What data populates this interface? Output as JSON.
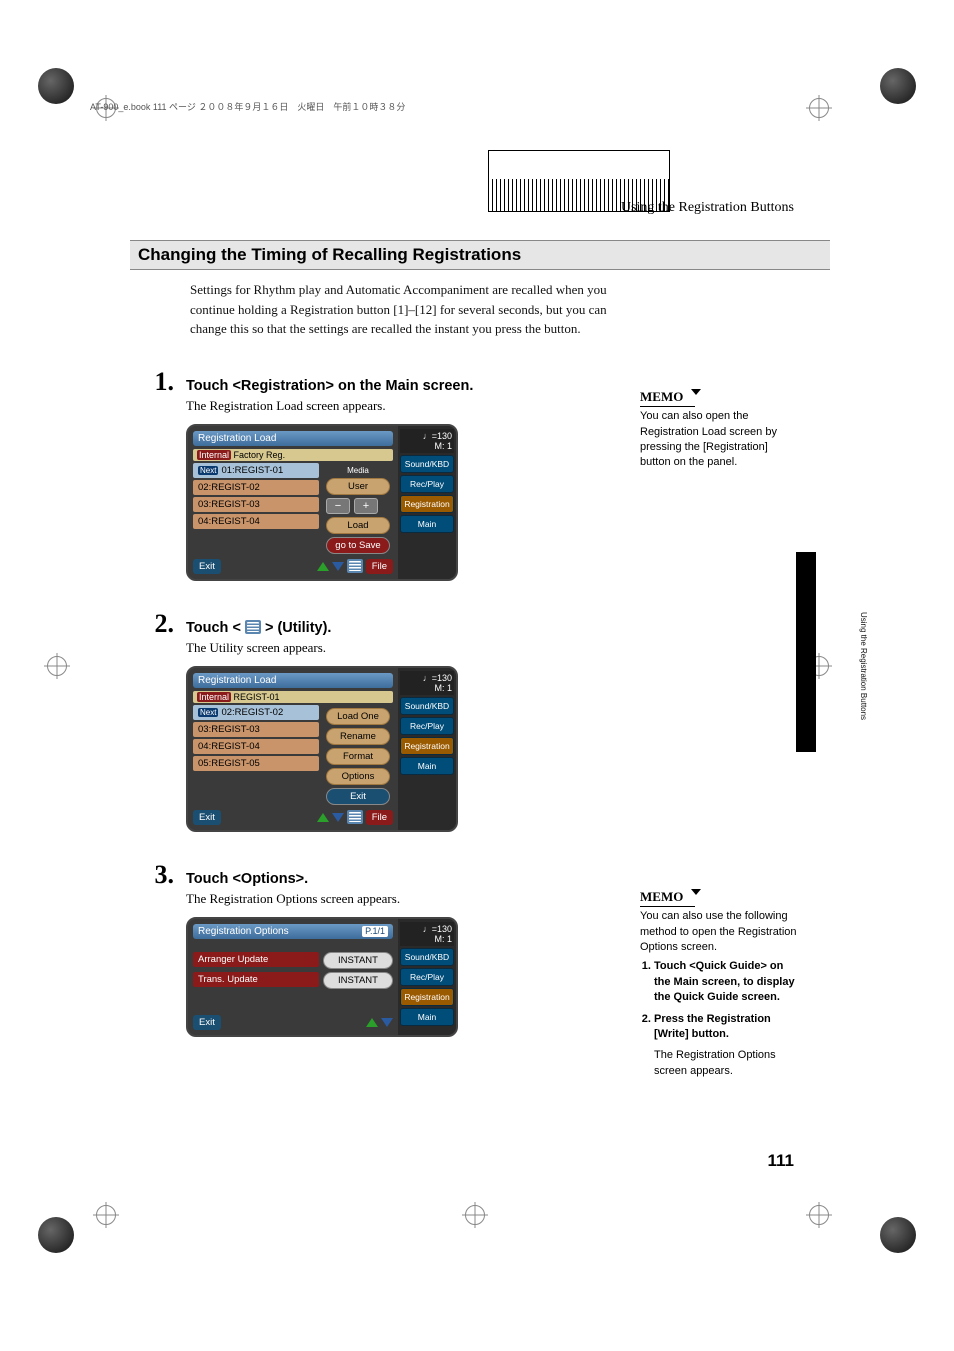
{
  "header_strip": "AT-900_e.book  111 ページ  ２００８年９月１６日　火曜日　午前１０時３８分",
  "running_head": "Using the Registration Buttons",
  "section_title": "Changing the Timing of Recalling Registrations",
  "intro": "Settings for Rhythm play and Automatic Accompaniment are recalled when you continue holding a Registration button [1]–[12] for several seconds, but you can change this so that the settings are recalled the instant you press the button.",
  "steps": [
    {
      "num": "1.",
      "title": "Touch <Registration> on the Main screen.",
      "sub": "The Registration Load screen appears."
    },
    {
      "num": "2.",
      "title_before": "Touch < ",
      "title_after": " > (Utility).",
      "sub": "The Utility screen appears."
    },
    {
      "num": "3.",
      "title": "Touch <Options>.",
      "sub": "The Registration Options screen appears."
    }
  ],
  "memo1": {
    "head": "MEMO",
    "text": "You can also open the Registration Load screen by pressing the [Registration] button on the panel."
  },
  "memo2": {
    "head": "MEMO",
    "text": "You can also use the following method to open the Registration Options screen.",
    "item1": "Touch <Quick Guide> on the Main screen, to display the Quick Guide screen.",
    "item2": "Press the Registration [Write] button.",
    "trail": "The Registration Options screen appears."
  },
  "screenshot1": {
    "title": "Registration Load",
    "top2_left": "Internal",
    "top2_right": "Factory Reg.",
    "media_label": "Media",
    "user_label": "User",
    "rows": [
      "01:REGIST-01",
      "02:REGIST-02",
      "03:REGIST-03",
      "04:REGIST-04"
    ],
    "next_badge": "Next",
    "minus": "−",
    "plus": "+",
    "load_btn": "Load",
    "go_save_btn": "go to Save",
    "exit_btn": "Exit",
    "file_btn": "File",
    "tempo": "♩=130",
    "measure": "M:   1",
    "side": [
      "Sound/KBD",
      "Rec/Play",
      "Registration",
      "Main"
    ]
  },
  "screenshot2": {
    "title": "Registration Load",
    "top2_left": "Internal",
    "top2_right": "REGIST-01",
    "rows": [
      "02:REGIST-02",
      "03:REGIST-03",
      "04:REGIST-04",
      "05:REGIST-05"
    ],
    "next_badge": "Next",
    "menu": [
      "Load One",
      "Rename",
      "Format",
      "Options",
      "Exit"
    ],
    "exit_btn": "Exit",
    "file_btn": "File",
    "tempo": "♩=130",
    "measure": "M:   1",
    "side": [
      "Sound/KBD",
      "Rec/Play",
      "Registration",
      "Main"
    ]
  },
  "screenshot3": {
    "title": "Registration Options",
    "page_badge": "P.1/1",
    "rows": [
      {
        "label": "Arranger Update",
        "value": "INSTANT"
      },
      {
        "label": "Trans. Update",
        "value": "INSTANT"
      }
    ],
    "exit_btn": "Exit",
    "tempo": "♩=130",
    "measure": "M:   1",
    "side": [
      "Sound/KBD",
      "Rec/Play",
      "Registration",
      "Main"
    ]
  },
  "vertical_tab_label": "Using the Registration Buttons",
  "page_number": "111"
}
